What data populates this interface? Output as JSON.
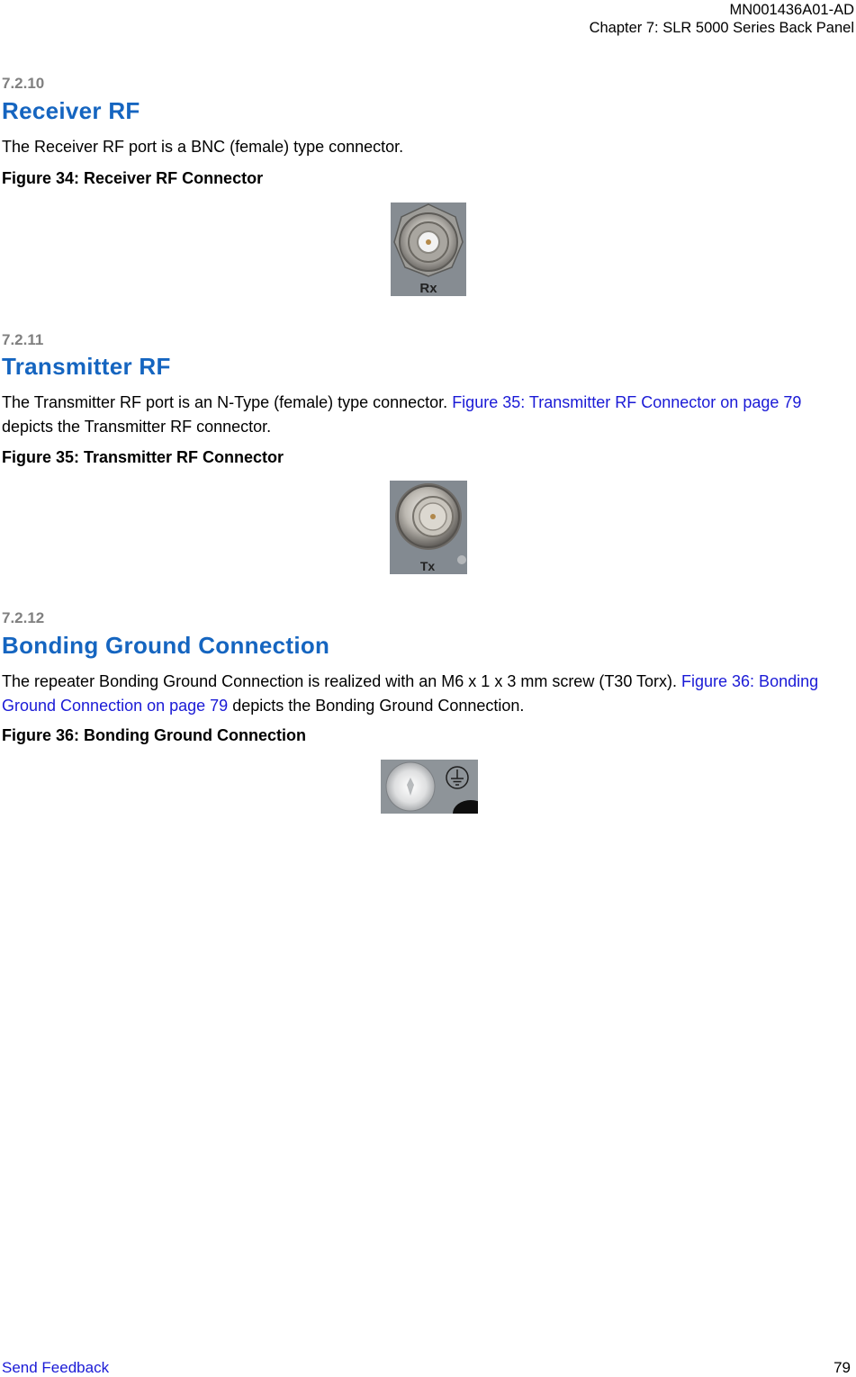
{
  "header": {
    "doc_id": "MN001436A01-AD",
    "chapter": "Chapter 7:  SLR 5000 Series Back Panel"
  },
  "sections": [
    {
      "number": "7.2.10",
      "title": "Receiver RF",
      "body_plain": "The Receiver RF port is a BNC (female) type connector.",
      "figure_caption": "Figure 34: Receiver RF Connector",
      "figure_label": "Rx",
      "figure_icon": "bnc-connector-photo"
    },
    {
      "number": "7.2.11",
      "title": "Transmitter RF",
      "body_before": "The Transmitter RF port is an N-Type (female) type connector. ",
      "body_link": "Figure 35: Transmitter RF Connector on page 79",
      "body_after": " depicts the Transmitter RF connector.",
      "figure_caption": "Figure 35: Transmitter RF Connector",
      "figure_label": "Tx",
      "figure_icon": "n-type-connector-photo"
    },
    {
      "number": "7.2.12",
      "title": "Bonding Ground Connection",
      "body_before": "The repeater Bonding Ground Connection is realized with an M6 x 1 x 3 mm screw (T30 Torx). ",
      "body_link": "Figure 36: Bonding Ground Connection on page 79",
      "body_after": " depicts the Bonding Ground Connection.",
      "figure_caption": "Figure 36: Bonding Ground Connection",
      "figure_icon": "ground-screw-photo"
    }
  ],
  "footer": {
    "feedback_link": "Send Feedback",
    "page_number": "79"
  },
  "colors": {
    "heading": "#1565c0",
    "section_number": "#808080",
    "link": "#1a1ad6"
  }
}
